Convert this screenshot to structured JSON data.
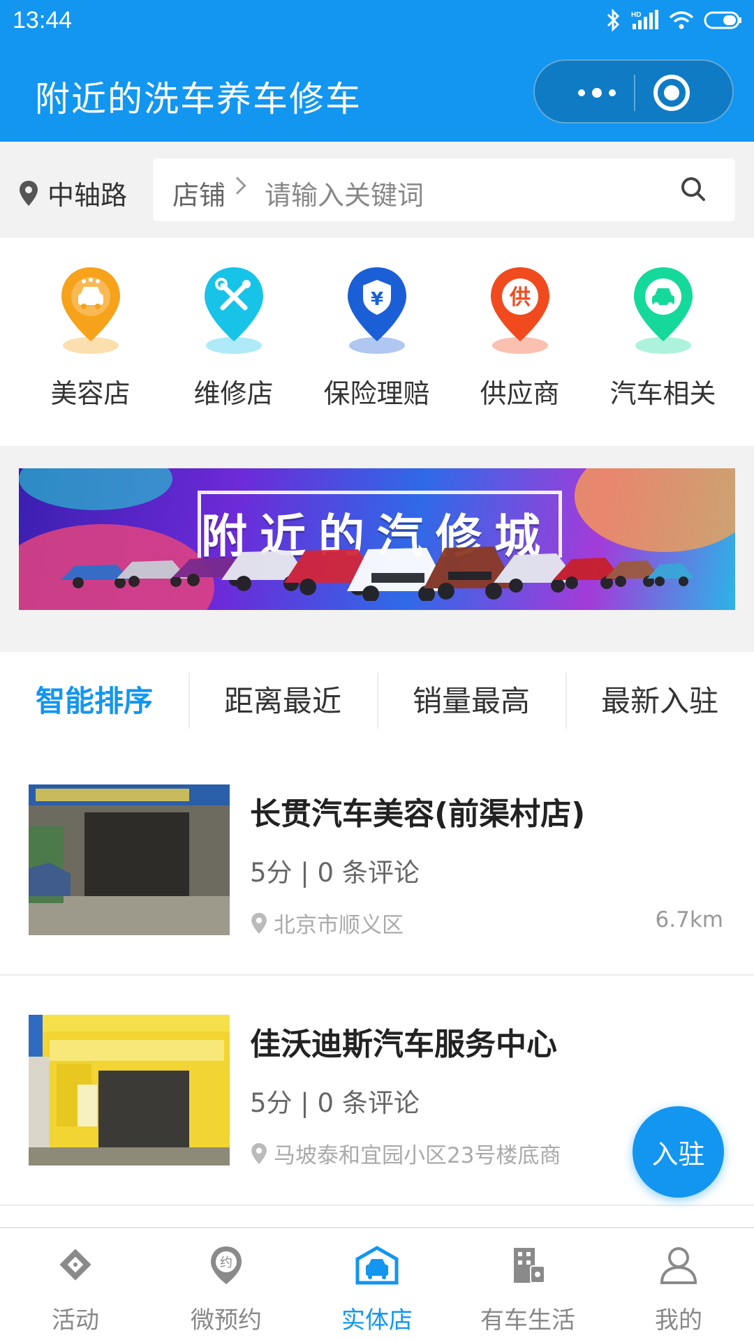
{
  "status": {
    "time": "13:44"
  },
  "header": {
    "title": "附近的洗车养车修车",
    "accent": "#1296f0"
  },
  "search": {
    "location": "中轴路",
    "scope": "店铺",
    "placeholder": "请输入关键词"
  },
  "categories": [
    {
      "label": "美容店",
      "icon": "car-wash-icon",
      "color": "#f7a21b"
    },
    {
      "label": "维修店",
      "icon": "repair-tools-icon",
      "color": "#18c3e8"
    },
    {
      "label": "保险理赔",
      "icon": "insurance-shield-icon",
      "color": "#1a5fd6"
    },
    {
      "label": "供应商",
      "icon": "supplier-icon",
      "color": "#f04a1e"
    },
    {
      "label": "汽车相关",
      "icon": "car-related-icon",
      "color": "#14d99a"
    }
  ],
  "banner": {
    "text": "附近的汽修城"
  },
  "sort_tabs": [
    {
      "label": "智能排序",
      "active": true
    },
    {
      "label": "距离最近",
      "active": false
    },
    {
      "label": "销量最高",
      "active": false
    },
    {
      "label": "最新入驻",
      "active": false
    }
  ],
  "shops": [
    {
      "name": "长贯汽车美容(前渠村店)",
      "rating": "5分 | 0 条评论",
      "address": "北京市顺义区",
      "distance": "6.7km"
    },
    {
      "name": "佳沃迪斯汽车服务中心",
      "rating": "5分 | 0 条评论",
      "address": "马坡泰和宜园小区23号楼底商",
      "distance": ""
    }
  ],
  "fab": {
    "label": "入驻"
  },
  "bottom_nav": [
    {
      "label": "活动",
      "icon": "activity-icon",
      "active": false
    },
    {
      "label": "微预约",
      "icon": "appointment-icon",
      "active": false
    },
    {
      "label": "实体店",
      "icon": "store-icon",
      "active": true
    },
    {
      "label": "有车生活",
      "icon": "car-life-icon",
      "active": false
    },
    {
      "label": "我的",
      "icon": "profile-icon",
      "active": false
    }
  ]
}
